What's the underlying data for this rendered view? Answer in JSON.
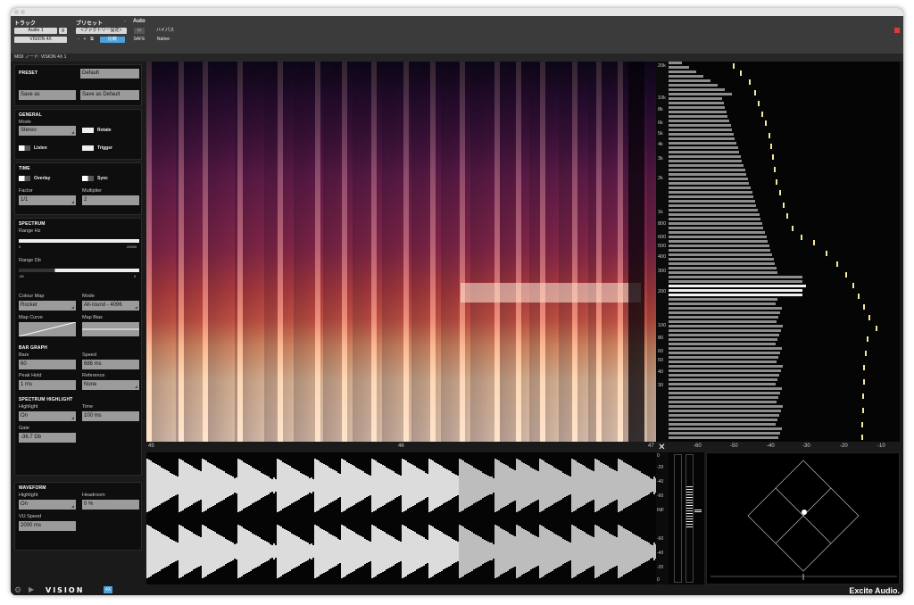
{
  "host": {
    "track_label": "トラック",
    "preset_label": "プリセット",
    "auto_label": "Auto",
    "track_value": "Audio 1",
    "track_mode": "g",
    "plugin_value": "VISION 4X",
    "preset_value": "<ファクトリー設定>",
    "compare_label": "比較",
    "safe_label": "SAFE",
    "bypass_label": "バイパス",
    "native_label": "Native",
    "plus_label": "+",
    "minus_label": "-"
  },
  "midi_node": "MIDI ノード: VISION 4X 1",
  "preset": {
    "title": "PRESET",
    "name_value": "Default",
    "save_as": "Save as",
    "save_default": "Save as Default"
  },
  "general": {
    "title": "GENERAL",
    "mode_label": "Mode",
    "mode_value": "Stereo",
    "rotate_label": "Rotate",
    "listen_label": "Listen",
    "trigger_label": "Trigger"
  },
  "time": {
    "title": "TIME",
    "overlay_label": "Overlay",
    "sync_label": "Sync",
    "factor_label": "Factor",
    "factor_value": "1/1",
    "multiplier_label": "Multiplier",
    "multiplier_value": "2"
  },
  "spectrum": {
    "title": "SPECTRUM",
    "range_hz_label": "Range Hz",
    "range_hz_min": "0",
    "range_hz_max": "20000",
    "range_db_label": "Range Db",
    "range_db_min": "-60",
    "range_db_max": "0",
    "colour_map_label": "Colour Map",
    "colour_map_value": "Rocket",
    "mode_label": "Mode",
    "mode_value": "All-round - 4096",
    "map_curve_label": "Map Curve",
    "map_bias_label": "Map Bias"
  },
  "bar_graph": {
    "title": "BAR GRAPH",
    "bars_label": "Bars",
    "bars_value": "60",
    "speed_label": "Speed",
    "speed_value": "686 ms",
    "peak_hold_label": "Peak Hold",
    "peak_hold_value": "1 ms",
    "reference_label": "Reference",
    "reference_value": "None"
  },
  "spectrum_highlight": {
    "title": "SPECTRUM HIGHLIGHT",
    "highlight_label": "Highlight",
    "highlight_value": "On",
    "time_label": "Time",
    "time_value": "100 ms",
    "gate_label": "Gate",
    "gate_value": "-36.7 Db"
  },
  "waveform": {
    "title": "WAVEFORM",
    "highlight_label": "Highlight",
    "highlight_value": "On",
    "headroom_label": "Headroom",
    "headroom_value": "0 %",
    "vu_speed_label": "VU Speed",
    "vu_speed_value": "2000 ms"
  },
  "freq_ticks": [
    "20k",
    "10k",
    "8k",
    "6k",
    "5k",
    "4k",
    "3k",
    "2k",
    "1k",
    "800",
    "600",
    "500",
    "400",
    "300",
    "200",
    "100",
    "80",
    "60",
    "50",
    "40",
    "30"
  ],
  "time_ticks": [
    "45",
    "46",
    "47"
  ],
  "db_ticks": [
    "-60",
    "-50",
    "-40",
    "-30",
    "-20",
    "-10"
  ],
  "level_ticks_top": [
    "0",
    "-20",
    "-40",
    "-60"
  ],
  "level_ticks_bottom": [
    "-60",
    "-40",
    "-20",
    "0"
  ],
  "level_inf": "INF",
  "footer": {
    "logo": "VISION",
    "badge": "4X",
    "brand": "Excite Audio."
  },
  "colors": {
    "accent": "#4aa3df",
    "peak": "#f4e8a0",
    "close_button": "#d93b3b"
  }
}
